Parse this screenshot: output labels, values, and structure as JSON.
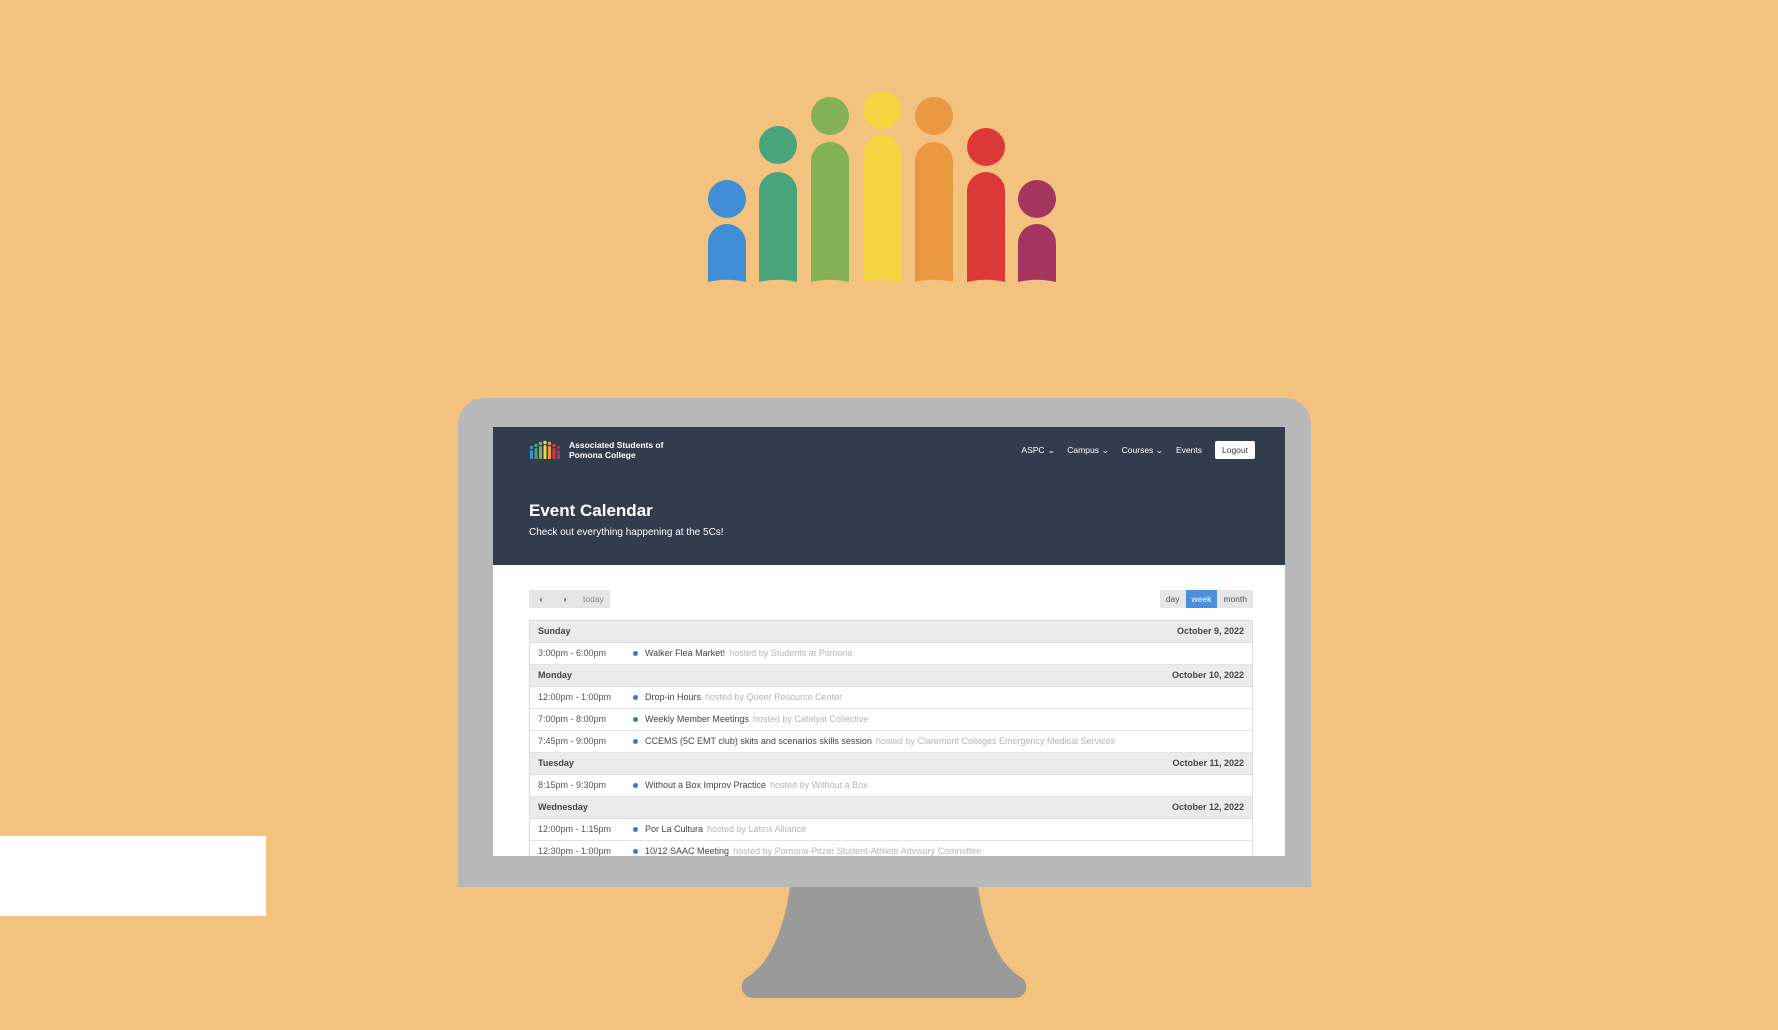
{
  "colors": {
    "background": "#F3C27E",
    "header": "#313C4D",
    "active_view": "#4A90D9",
    "event_dot": "#2D7EC4",
    "logo": [
      "#3F8ED6",
      "#48A47B",
      "#84B056",
      "#F5D442",
      "#EA9841",
      "#DC3837",
      "#A33560"
    ]
  },
  "site": {
    "brand_line1": "Associated Students of",
    "brand_line2": "Pomona College",
    "nav": [
      {
        "label": "ASPC",
        "dropdown": true
      },
      {
        "label": "Campus",
        "dropdown": true
      },
      {
        "label": "Courses",
        "dropdown": true
      },
      {
        "label": "Events",
        "dropdown": false
      }
    ],
    "logout": "Logout"
  },
  "page": {
    "title": "Event Calendar",
    "subtitle": "Check out everything happening at the 5Cs!"
  },
  "toolbar": {
    "prev_icon": "‹",
    "next_icon": "›",
    "today": "today",
    "views": [
      "day",
      "week",
      "month"
    ],
    "active_view": "week"
  },
  "days": [
    {
      "day": "Sunday",
      "date": "October 9, 2022",
      "events": [
        {
          "time": "3:00pm - 6:00pm",
          "title": "Walker Flea Market!",
          "host": "hosted by Students at Pomona"
        }
      ]
    },
    {
      "day": "Monday",
      "date": "October 10, 2022",
      "events": [
        {
          "time": "12:00pm - 1:00pm",
          "title": "Drop-in Hours",
          "host": "hosted by Queer Resource Center"
        },
        {
          "time": "7:00pm - 8:00pm",
          "title": "Weekly Member Meetings",
          "host": "hosted by Catalyst Collective"
        },
        {
          "time": "7:45pm - 9:00pm",
          "title": "CCEMS (5C EMT club) skits and scenarios skills session",
          "host": "hosted by Claremont Colleges Emergency Medical Services"
        }
      ]
    },
    {
      "day": "Tuesday",
      "date": "October 11, 2022",
      "events": [
        {
          "time": "8:15pm - 9:30pm",
          "title": "Without a Box Improv Practice",
          "host": "hosted by Without a Box"
        }
      ]
    },
    {
      "day": "Wednesday",
      "date": "October 12, 2022",
      "events": [
        {
          "time": "12:00pm - 1:15pm",
          "title": "Por La Cultura",
          "host": "hosted by Latinx Alliance"
        },
        {
          "time": "12:30pm - 1:00pm",
          "title": "10/12 SAAC Meeting",
          "host": "hosted by Pomona-Pitzer Student-Athlete Advisory Committee"
        }
      ]
    }
  ]
}
